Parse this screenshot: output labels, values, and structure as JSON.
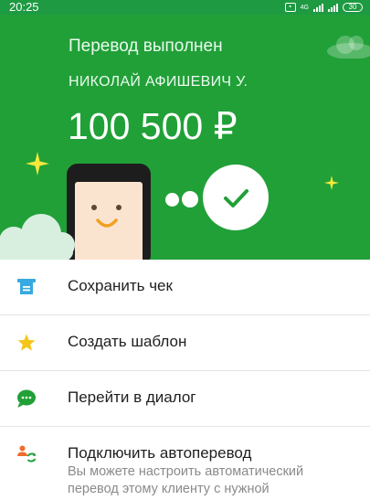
{
  "status_bar": {
    "time": "20:25",
    "network": "4G",
    "battery": "30"
  },
  "hero": {
    "title": "Перевод выполнен",
    "recipient": "НИКОЛАЙ АФИШЕВИЧ У.",
    "amount": "100 500 ₽",
    "background_color": "#21a038"
  },
  "menu": {
    "items": [
      {
        "label": "Сохранить чек",
        "icon": "receipt-icon"
      },
      {
        "label": "Создать шаблон",
        "icon": "star-icon"
      },
      {
        "label": "Перейти в диалог",
        "icon": "chat-icon"
      },
      {
        "label": "Подключить автоперевод",
        "icon": "autotransfer-icon",
        "description_line1": "Вы можете настроить автоматический",
        "description_line2": "перевод этому клиенту с нужной"
      }
    ]
  }
}
